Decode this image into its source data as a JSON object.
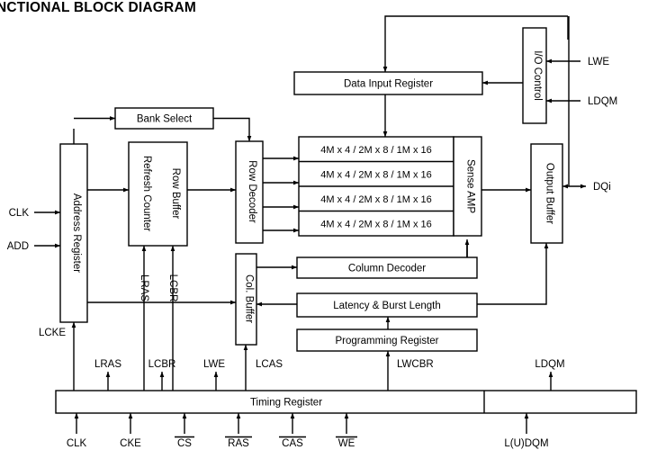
{
  "document": {
    "title": "NCTIONAL BLOCK DIAGRAM"
  },
  "blocks": {
    "bank_select": "Bank Select",
    "address_register": "Address Register",
    "refresh_counter": "Refresh Counter",
    "row_buffer": "Row Buffer",
    "row_decoder": "Row Decoder",
    "col_buffer": "Col. Buffer",
    "sense_amp": "Sense AMP",
    "data_input_register": "Data Input Register",
    "io_control": "I/O Control",
    "output_buffer": "Output Buffer",
    "column_decoder": "Column Decoder",
    "latency_burst_length": "Latency & Burst Length",
    "programming_register": "Programming Register",
    "timing_register": "Timing Register"
  },
  "memory_array": {
    "rows": [
      "4M x 4 / 2M x 8 / 1M x 16",
      "4M x 4 / 2M x 8 / 1M x 16",
      "4M x 4 / 2M x 8 / 1M x 16",
      "4M x 4 / 2M x 8 / 1M x 16"
    ]
  },
  "signals": {
    "left_inputs": [
      {
        "label": "CLK"
      },
      {
        "label": "ADD"
      }
    ],
    "internal": [
      {
        "label": "LRAS"
      },
      {
        "label": "LCBR"
      },
      {
        "label": "LCKE"
      },
      {
        "label": "LWE"
      },
      {
        "label": "LDQM"
      },
      {
        "label": "LCAS"
      },
      {
        "label": "LWCBR"
      }
    ],
    "right_io": [
      {
        "label": "LWE"
      },
      {
        "label": "LDQM"
      },
      {
        "label": "DQi"
      }
    ],
    "timing_outputs": [
      {
        "label": "LRAS"
      },
      {
        "label": "LCBR"
      },
      {
        "label": "LWE"
      },
      {
        "label": "LCAS"
      },
      {
        "label": "LWCBR"
      },
      {
        "label": "LDQM"
      }
    ],
    "timing_inputs": [
      {
        "label": "CLK",
        "overline": false
      },
      {
        "label": "CKE",
        "overline": false
      },
      {
        "label": "CS",
        "overline": true
      },
      {
        "label": "RAS",
        "overline": true
      },
      {
        "label": "CAS",
        "overline": true
      },
      {
        "label": "WE",
        "overline": true
      },
      {
        "label": "L(U)DQM",
        "overline": false
      }
    ]
  },
  "colors": {
    "stroke": "#000000",
    "background": "#ffffff",
    "text": "#000000"
  }
}
